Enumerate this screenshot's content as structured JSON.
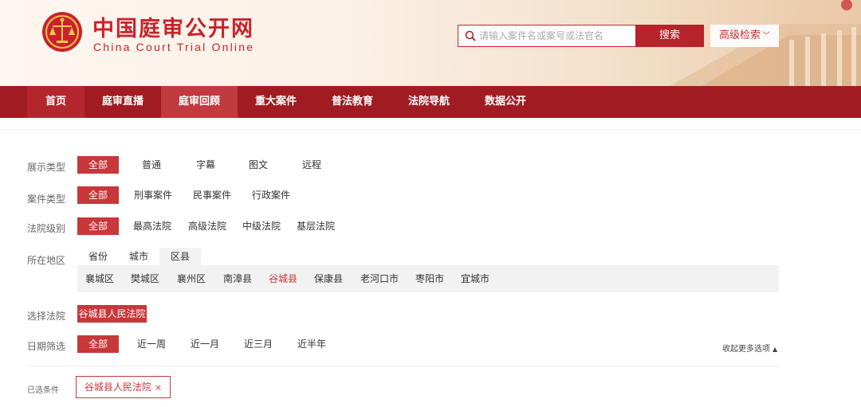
{
  "header": {
    "title_cn": "中国庭审公开网",
    "title_en": "China Court Trial Online",
    "search": {
      "placeholder": "请输入案件名或案号或法官名",
      "value": "",
      "button_label": "搜索"
    },
    "advanced_search_label": "高级检索",
    "brand_color": "#c8232c"
  },
  "nav": {
    "items": [
      "首页",
      "庭审直播",
      "庭审回顾",
      "重大案件",
      "普法教育",
      "法院导航",
      "数据公开"
    ],
    "active": "庭审回顾"
  },
  "filters": {
    "display_type": {
      "label": "展示类型",
      "options": [
        "全部",
        "普通",
        "字幕",
        "图文",
        "远程"
      ],
      "selected": "全部"
    },
    "case_type": {
      "label": "案件类型",
      "options": [
        "全部",
        "刑事案件",
        "民事案件",
        "行政案件"
      ],
      "selected": "全部"
    },
    "court_level": {
      "label": "法院级别",
      "options": [
        "全部",
        "最高法院",
        "高级法院",
        "中级法院",
        "基层法院"
      ],
      "selected": "全部"
    },
    "region": {
      "label": "所在地区",
      "tabs": [
        "省份",
        "城市",
        "区县"
      ],
      "active_tab": "区县",
      "items": [
        "襄城区",
        "樊城区",
        "襄州区",
        "南漳县",
        "谷城县",
        "保康县",
        "老河口市",
        "枣阳市",
        "宜城市"
      ],
      "selected": "谷城县"
    },
    "court": {
      "label": "选择法院",
      "selected": "谷城县人民法院"
    },
    "date": {
      "label": "日期筛选",
      "options": [
        "全部",
        "近一周",
        "近一月",
        "近三月",
        "近半年"
      ],
      "selected": "全部"
    },
    "collapse_label": "收起更多选项"
  },
  "selected_conditions": {
    "label": "已选条件",
    "tags": [
      "谷城县人民法院"
    ],
    "remove_icon": "close-icon"
  },
  "colors": {
    "accent": "#c8373a",
    "nav_bg": "#a11c22"
  }
}
